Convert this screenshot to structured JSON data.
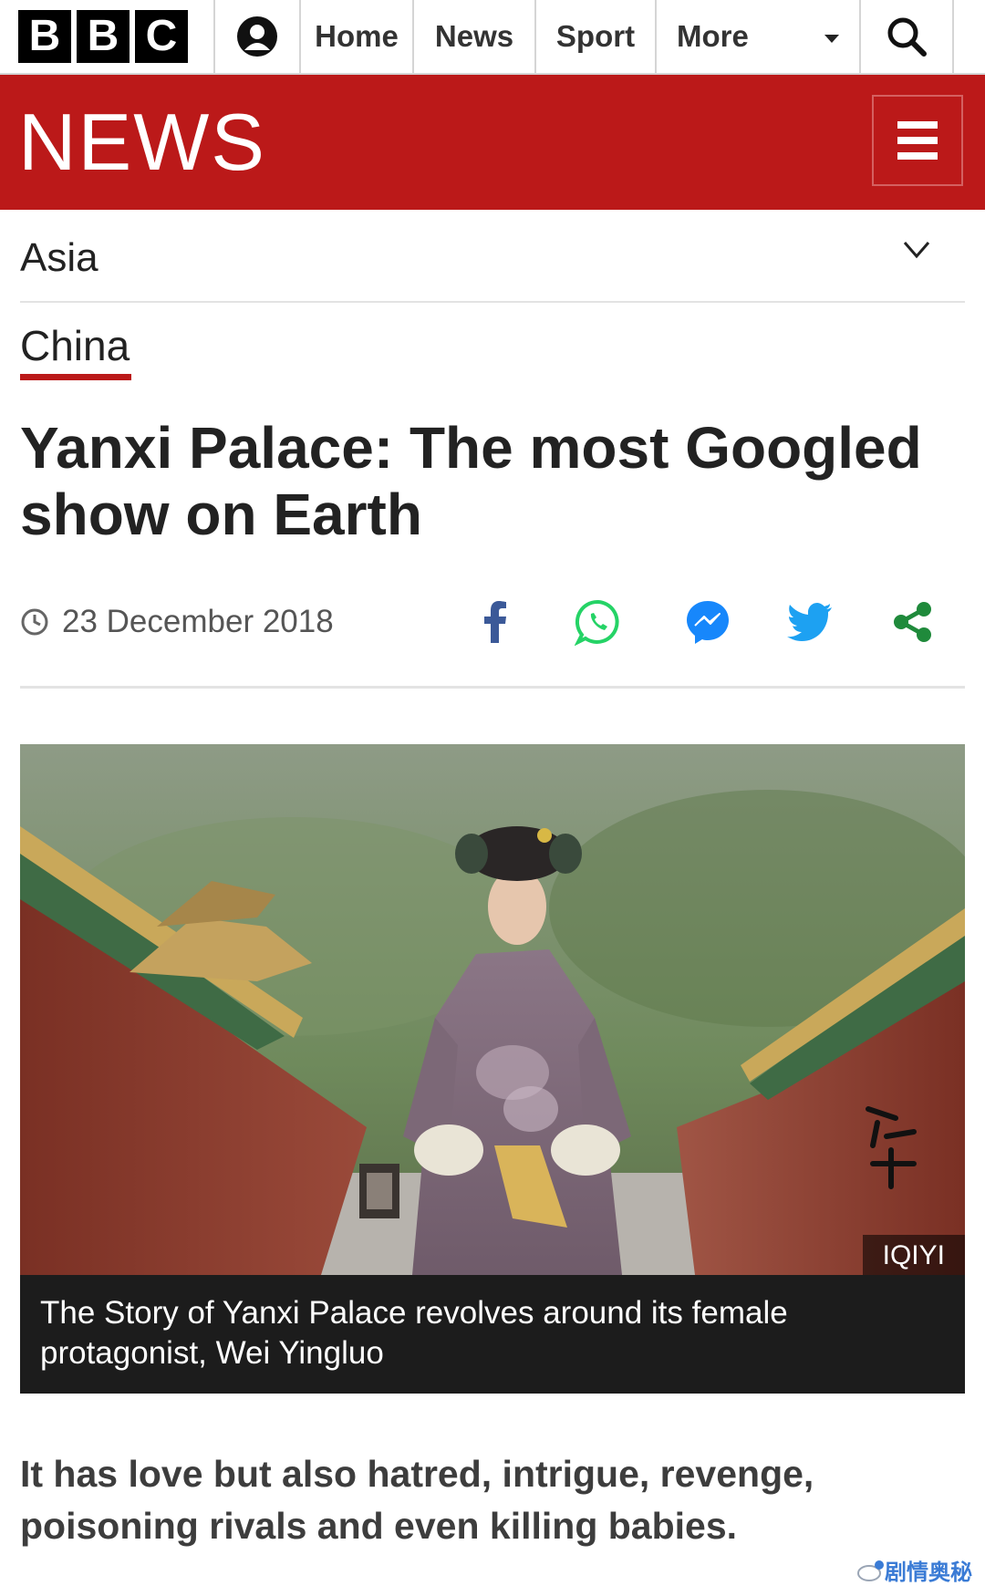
{
  "topnav": {
    "logo_letters": [
      "B",
      "B",
      "C"
    ],
    "links": [
      "Home",
      "News",
      "Sport"
    ],
    "more_label": "More"
  },
  "brand": {
    "news_label": "NEWS",
    "color": "#bb1919"
  },
  "section": {
    "label": "Asia",
    "tag": "China"
  },
  "article": {
    "headline": "Yanxi Palace: The most Googled show on Earth",
    "date": "23 December 2018",
    "share": [
      "facebook-icon",
      "whatsapp-icon",
      "messenger-icon",
      "twitter-icon",
      "share-icon"
    ],
    "image_credit": "IQIYI",
    "caption": "The Story of Yanxi Palace revolves around its female protagonist, Wei Yingluo",
    "intro": "It has love but also hatred, intrigue, revenge, poisoning rivals and even killing babies."
  },
  "watermark": "剧情奥秘"
}
